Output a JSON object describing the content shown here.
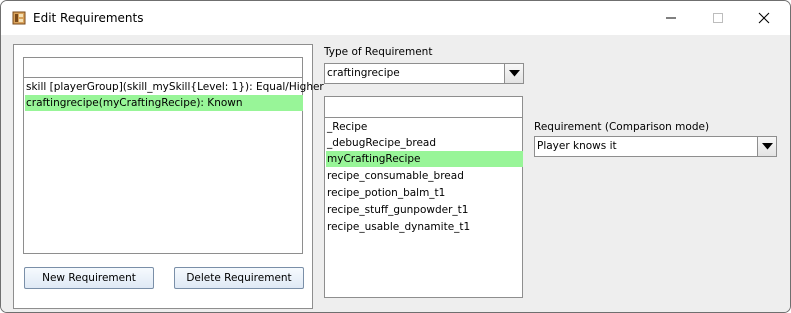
{
  "window": {
    "title": "Edit Requirements",
    "icons": {
      "app": "app-icon",
      "minimize": "minimize-icon",
      "maximize": "maximize-icon",
      "close": "close-icon"
    }
  },
  "requirements_panel": {
    "filter_value": "",
    "items": [
      {
        "label": "skill [playerGroup](skill_mySkill{Level: 1}): Equal/Higher",
        "selected": false
      },
      {
        "label": "craftingrecipe(myCraftingRecipe): Known",
        "selected": true
      }
    ],
    "new_button": "New Requirement",
    "delete_button": "Delete Requirement"
  },
  "type_section": {
    "label": "Type of Requirement",
    "selected": "craftingrecipe"
  },
  "recipe_list": {
    "filter_value": "",
    "items": [
      {
        "label": "_Recipe",
        "selected": false
      },
      {
        "label": "_debugRecipe_bread",
        "selected": false
      },
      {
        "label": "myCraftingRecipe",
        "selected": true
      },
      {
        "label": "recipe_consumable_bread",
        "selected": false
      },
      {
        "label": "recipe_potion_balm_t1",
        "selected": false
      },
      {
        "label": "recipe_stuff_gunpowder_t1",
        "selected": false
      },
      {
        "label": "recipe_usable_dynamite_t1",
        "selected": false
      }
    ]
  },
  "comparison_section": {
    "label": "Requirement (Comparison mode)",
    "selected": "Player knows it"
  },
  "colors": {
    "selection": "#98f598",
    "background": "#eeeeee"
  }
}
